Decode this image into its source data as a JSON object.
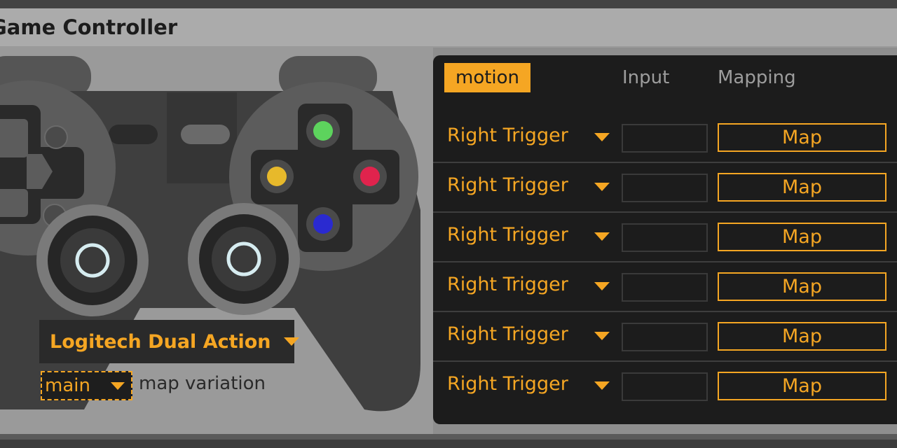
{
  "window": {
    "title": "Game Controller"
  },
  "device": {
    "name": "Logitech Dual Action"
  },
  "variation": {
    "value": "main",
    "label": "map variation"
  },
  "tabs": [
    {
      "label": "motion",
      "active": true
    },
    {
      "label": "Input",
      "active": false
    },
    {
      "label": "Mapping",
      "active": false
    }
  ],
  "rows": [
    {
      "control": "Right Trigger",
      "input": "",
      "button": "Map"
    },
    {
      "control": "Right Trigger",
      "input": "",
      "button": "Map"
    },
    {
      "control": "Right Trigger",
      "input": "",
      "button": "Map"
    },
    {
      "control": "Right Trigger",
      "input": "",
      "button": "Map"
    },
    {
      "control": "Right Trigger",
      "input": "",
      "button": "Map"
    },
    {
      "control": "Right Trigger",
      "input": "",
      "button": "Map"
    }
  ],
  "colors": {
    "accent": "#f5a623",
    "button_green": "#5dd35d",
    "button_red": "#e0234d",
    "button_yellow": "#e7b92b",
    "button_blue": "#2a2ad0"
  }
}
